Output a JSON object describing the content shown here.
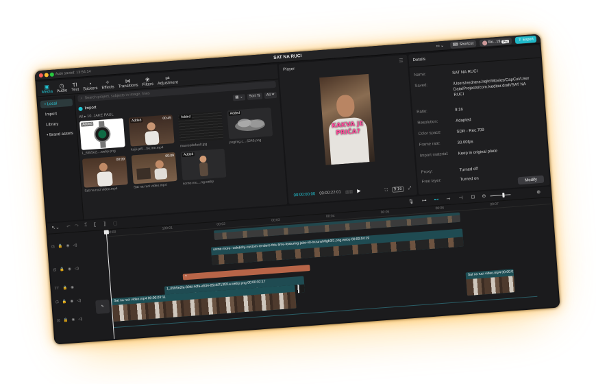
{
  "window": {
    "autosave": "Auto saved: 13:54:14",
    "title": "SAT NA RUCI",
    "shortcut_label": "Shortcut",
    "account_label": "Bo...19",
    "pro_badge": "Pro",
    "export_label": "Export"
  },
  "media_tabs": [
    {
      "label": "Media",
      "icon": "media-icon"
    },
    {
      "label": "Audio",
      "icon": "audio-icon"
    },
    {
      "label": "Text",
      "icon": "text-icon"
    },
    {
      "label": "Stickers",
      "icon": "sticker-icon"
    },
    {
      "label": "Effects",
      "icon": "effects-icon"
    },
    {
      "label": "Transitions",
      "icon": "transitions-icon"
    },
    {
      "label": "Filters",
      "icon": "filters-icon"
    },
    {
      "label": "Adjustment",
      "icon": "adjustment-icon"
    }
  ],
  "sidebar": {
    "items": [
      "• Local",
      "Import",
      "Library",
      "• Brand assets"
    ]
  },
  "library": {
    "search_placeholder": "Search project, subjects in image, lines",
    "import_label": "Import",
    "sort_label": "Sort",
    "all_label": "All",
    "breadcrumb": "All  ▸  10. JAKE PAUL",
    "items": [
      {
        "name": "1_65b5e2....webp.png",
        "added": "Added",
        "duration": ""
      },
      {
        "name": "kojii-jeff....be.me.mp4",
        "added": "Added",
        "duration": "00:45"
      },
      {
        "name": "maxresdefault.jpg",
        "added": "Added",
        "duration": ""
      },
      {
        "name": "pngimg.c....5245.png",
        "added": "Added",
        "duration": ""
      },
      {
        "name": "Sat na ruci video.mp4",
        "added": "",
        "duration": "00:09"
      },
      {
        "name": "Sat na ruci video.mp4",
        "added": "",
        "duration": "00:09"
      },
      {
        "name": "some-mo....ng.webp",
        "added": "Added",
        "duration": ""
      }
    ]
  },
  "player": {
    "title": "Player",
    "overlay_line1": "KAKVA JE",
    "overlay_line2": "PRIČA?",
    "current_time": "00:00:00:00",
    "total_time": "00:00:22:01",
    "ratio_button": "9:16"
  },
  "details": {
    "title": "Details",
    "modify_label": "Modify",
    "rows": [
      {
        "key": "Name:",
        "value": "SAT NA RUCI"
      },
      {
        "key": "Saved:",
        "value": "/Users/vedrans.hejic/Movies/CapCut/User Data/Projects/com.lveditor.draft/SAT NA RUCI"
      },
      {
        "key": "Ratio:",
        "value": "9:16"
      },
      {
        "key": "Resolution:",
        "value": "Adapted"
      },
      {
        "key": "Color space:",
        "value": "SDR - Rec.709"
      },
      {
        "key": "Frame rate:",
        "value": "30.00fps"
      },
      {
        "key": "Import material:",
        "value": "Keep in original place"
      },
      {
        "key": "Proxy:",
        "value": "Turned off"
      },
      {
        "key": "Free layer:",
        "value": "Turned on"
      }
    ]
  },
  "timeline": {
    "ruler": [
      "00:00",
      "100:01",
      "00:02",
      "00:03",
      "00:04",
      "00:05",
      "00:06",
      "00:07"
    ],
    "clips": {
      "main": "Sat na ruci video.mp4  00:00:03:11",
      "main_end": "Sat na ruci video.mp4  00:00:01:07",
      "overlay": "some-more--celebrity-custom-renders-this-time-featuring-jake-v0-hxrunsh0gb3f1.png.webp  00:00:04:19",
      "sticker": "1_65b5e2fa-80fd-4dfa-a534-05cfd713f21a.webp.png  00:00:02:17",
      "text": "?"
    },
    "cover_label": "Cover"
  },
  "colors": {
    "accent": "#21c7d6",
    "main_clip": "#1e4f55",
    "text_clip": "#b86548",
    "overlay_clip": "#1f4b52"
  }
}
